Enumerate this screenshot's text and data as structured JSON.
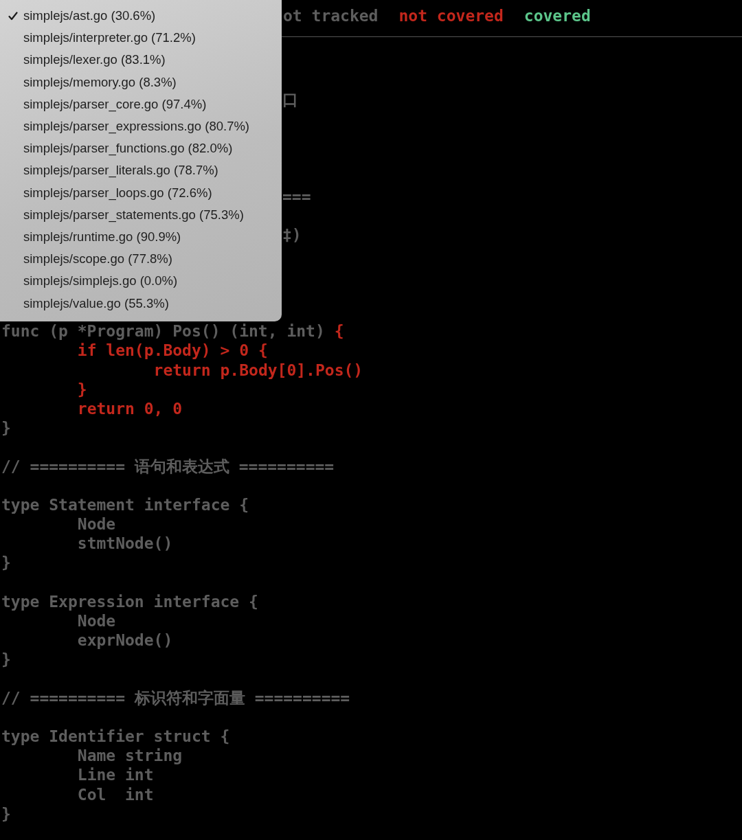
{
  "legend": [
    {
      "label": "ot tracked",
      "color": "#5e5e5e"
    },
    {
      "label": "not covered",
      "color": "#c3271c"
    },
    {
      "label": "covered",
      "color": "#5cc68b"
    }
  ],
  "file_menu": [
    {
      "label": "simplejs/ast.go (30.6%)",
      "selected": true
    },
    {
      "label": "simplejs/interpreter.go (71.2%)",
      "selected": false
    },
    {
      "label": "simplejs/lexer.go (83.1%)",
      "selected": false
    },
    {
      "label": "simplejs/memory.go (8.3%)",
      "selected": false
    },
    {
      "label": "simplejs/parser_core.go (97.4%)",
      "selected": false
    },
    {
      "label": "simplejs/parser_expressions.go (80.7%)",
      "selected": false
    },
    {
      "label": "simplejs/parser_functions.go (82.0%)",
      "selected": false
    },
    {
      "label": "simplejs/parser_literals.go (78.7%)",
      "selected": false
    },
    {
      "label": "simplejs/parser_loops.go (72.6%)",
      "selected": false
    },
    {
      "label": "simplejs/parser_statements.go (75.3%)",
      "selected": false
    },
    {
      "label": "simplejs/runtime.go (90.9%)",
      "selected": false
    },
    {
      "label": "simplejs/scope.go (77.8%)",
      "selected": false
    },
    {
      "label": "simplejs/simplejs.go (0.0%)",
      "selected": false
    },
    {
      "label": "simplejs/value.go (55.3%)",
      "selected": false
    }
  ],
  "code_lines": [
    {
      "kind": "blank"
    },
    {
      "kind": "blank"
    },
    {
      "kind": "clipped",
      "segments": [
        {
          "text": "口",
          "color": "#5e5e5e"
        }
      ]
    },
    {
      "kind": "blank"
    },
    {
      "kind": "blank"
    },
    {
      "kind": "blank"
    },
    {
      "kind": "blank"
    },
    {
      "kind": "clipped",
      "segments": [
        {
          "text": "===",
          "color": "#5e5e5e"
        }
      ]
    },
    {
      "kind": "blank"
    },
    {
      "kind": "clipped",
      "segments": [
        {
          "text": "‡)",
          "color": "#5e5e5e"
        }
      ]
    },
    {
      "kind": "blank"
    },
    {
      "kind": "blank"
    },
    {
      "kind": "blank"
    },
    {
      "kind": "blank"
    },
    {
      "kind": "code",
      "segments": [
        {
          "text": "func (p *Program) Pos() (int, int) ",
          "color": "#5e5e5e"
        },
        {
          "text": "{",
          "color": "#c3271c"
        }
      ]
    },
    {
      "kind": "code",
      "segments": [
        {
          "text": "\tif len(p.Body) > 0 {",
          "color": "#c3271c"
        }
      ]
    },
    {
      "kind": "code",
      "segments": [
        {
          "text": "\t\treturn p.Body[0].Pos()",
          "color": "#c3271c"
        }
      ]
    },
    {
      "kind": "code",
      "segments": [
        {
          "text": "\t}",
          "color": "#c3271c"
        }
      ]
    },
    {
      "kind": "code",
      "segments": [
        {
          "text": "\treturn 0, 0",
          "color": "#c3271c"
        }
      ]
    },
    {
      "kind": "code",
      "segments": [
        {
          "text": "}",
          "color": "#5e5e5e"
        }
      ]
    },
    {
      "kind": "blank"
    },
    {
      "kind": "code",
      "segments": [
        {
          "text": "// ========== 语句和表达式 ==========",
          "color": "#5e5e5e"
        }
      ]
    },
    {
      "kind": "blank"
    },
    {
      "kind": "code",
      "segments": [
        {
          "text": "type Statement interface {",
          "color": "#5e5e5e"
        }
      ]
    },
    {
      "kind": "code",
      "segments": [
        {
          "text": "\tNode",
          "color": "#5e5e5e"
        }
      ]
    },
    {
      "kind": "code",
      "segments": [
        {
          "text": "\tstmtNode()",
          "color": "#5e5e5e"
        }
      ]
    },
    {
      "kind": "code",
      "segments": [
        {
          "text": "}",
          "color": "#5e5e5e"
        }
      ]
    },
    {
      "kind": "blank"
    },
    {
      "kind": "code",
      "segments": [
        {
          "text": "type Expression interface {",
          "color": "#5e5e5e"
        }
      ]
    },
    {
      "kind": "code",
      "segments": [
        {
          "text": "\tNode",
          "color": "#5e5e5e"
        }
      ]
    },
    {
      "kind": "code",
      "segments": [
        {
          "text": "\texprNode()",
          "color": "#5e5e5e"
        }
      ]
    },
    {
      "kind": "code",
      "segments": [
        {
          "text": "}",
          "color": "#5e5e5e"
        }
      ]
    },
    {
      "kind": "blank"
    },
    {
      "kind": "code",
      "segments": [
        {
          "text": "// ========== 标识符和字面量 ==========",
          "color": "#5e5e5e"
        }
      ]
    },
    {
      "kind": "blank"
    },
    {
      "kind": "code",
      "segments": [
        {
          "text": "type Identifier struct {",
          "color": "#5e5e5e"
        }
      ]
    },
    {
      "kind": "code",
      "segments": [
        {
          "text": "\tName string",
          "color": "#5e5e5e"
        }
      ]
    },
    {
      "kind": "code",
      "segments": [
        {
          "text": "\tLine int",
          "color": "#5e5e5e"
        }
      ]
    },
    {
      "kind": "code",
      "segments": [
        {
          "text": "\tCol  int",
          "color": "#5e5e5e"
        }
      ]
    },
    {
      "kind": "code",
      "segments": [
        {
          "text": "}",
          "color": "#5e5e5e"
        }
      ]
    }
  ]
}
